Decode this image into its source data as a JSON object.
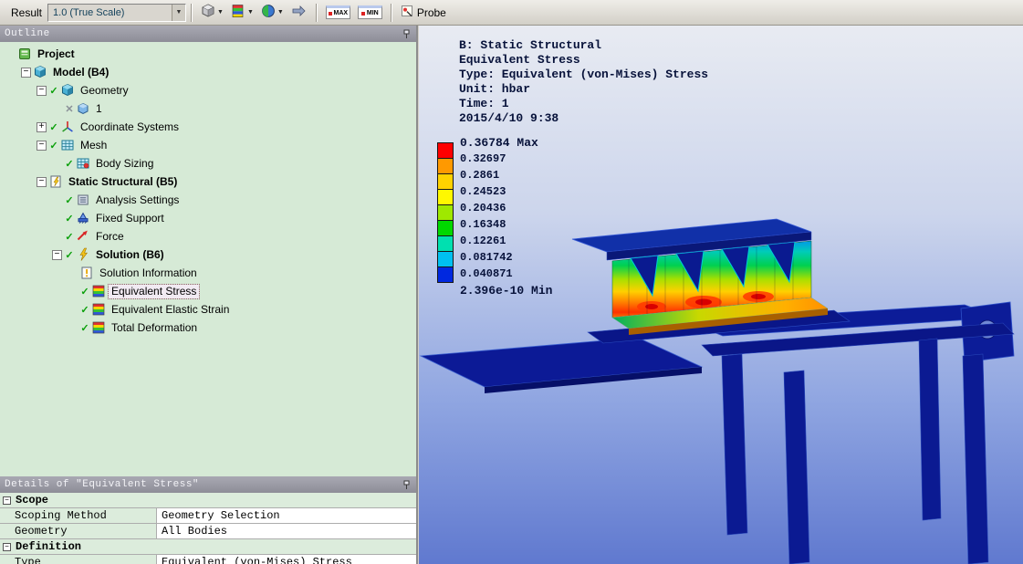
{
  "toolbar": {
    "result_label": "Result",
    "scale_value": "1.0 (True Scale)",
    "max_label": "MAX",
    "min_label": "MIN",
    "probe_label": "Probe"
  },
  "outline": {
    "title": "Outline",
    "tree": [
      {
        "label": "Project",
        "level": 0,
        "icon": "project",
        "bold": true
      },
      {
        "label": "Model (B4)",
        "level": 1,
        "icon": "model",
        "expander": "minus",
        "bold": true
      },
      {
        "label": "Geometry",
        "level": 2,
        "icon": "geometry",
        "expander": "minus",
        "mark": "check"
      },
      {
        "label": "1",
        "level": 3,
        "icon": "body",
        "mark": "x"
      },
      {
        "label": "Coordinate Systems",
        "level": 2,
        "icon": "coord",
        "expander": "plus",
        "mark": "check"
      },
      {
        "label": "Mesh",
        "level": 2,
        "icon": "mesh",
        "expander": "minus",
        "mark": "check"
      },
      {
        "label": "Body Sizing",
        "level": 3,
        "icon": "bodysizing",
        "mark": "check"
      },
      {
        "label": "Static Structural (B5)",
        "level": 2,
        "icon": "static",
        "expander": "minus",
        "bold": true
      },
      {
        "label": "Analysis Settings",
        "level": 3,
        "icon": "settings",
        "mark": "check"
      },
      {
        "label": "Fixed Support",
        "level": 3,
        "icon": "fixed",
        "mark": "check"
      },
      {
        "label": "Force",
        "level": 3,
        "icon": "force",
        "mark": "check"
      },
      {
        "label": "Solution (B6)",
        "level": 3,
        "icon": "solution",
        "expander": "minus",
        "bold": true,
        "mark": "check"
      },
      {
        "label": "Solution Information",
        "level": 4,
        "icon": "solinfo"
      },
      {
        "label": "Equivalent Stress",
        "level": 4,
        "icon": "result",
        "mark": "check",
        "selected": true
      },
      {
        "label": "Equivalent Elastic Strain",
        "level": 4,
        "icon": "result",
        "mark": "check"
      },
      {
        "label": "Total Deformation",
        "level": 4,
        "icon": "result",
        "mark": "check"
      }
    ]
  },
  "details": {
    "title": "Details of \"Equivalent Stress\"",
    "rows": [
      {
        "type": "section",
        "label": "Scope"
      },
      {
        "type": "pair",
        "label": "Scoping Method",
        "value": "Geometry Selection"
      },
      {
        "type": "pair",
        "label": "Geometry",
        "value": "All Bodies"
      },
      {
        "type": "section",
        "label": "Definition"
      },
      {
        "type": "pair",
        "label": "Type",
        "value": "Equivalent (von-Mises) Stress"
      }
    ]
  },
  "viewport": {
    "annotations": [
      "B: Static Structural",
      "Equivalent Stress",
      "Type: Equivalent (von-Mises) Stress",
      "Unit: hbar",
      "Time: 1",
      "2015/4/10 9:38"
    ],
    "legend": {
      "labels": [
        "0.36784 Max",
        "0.32697",
        "0.2861",
        "0.24523",
        "0.20436",
        "0.16348",
        "0.12261",
        "0.081742",
        "0.040871",
        "2.396e-10 Min"
      ],
      "colors": [
        "#ff0000",
        "#ff9900",
        "#ffd200",
        "#fff800",
        "#9fe800",
        "#00d800",
        "#00e0b0",
        "#00c0f0",
        "#0028e0"
      ]
    }
  }
}
